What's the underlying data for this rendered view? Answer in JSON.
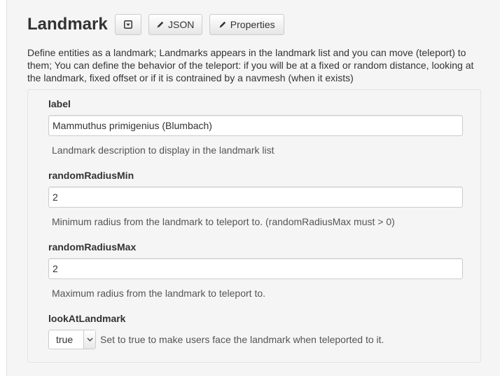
{
  "header": {
    "title": "Landmark",
    "json_button_label": "JSON",
    "properties_button_label": "Properties"
  },
  "description": "Define entities as a landmark; Landmarks appears in the landmark list and you can move (teleport) to them; You can define the behavior of the teleport: if you will be at a fixed or random distance, looking at the landmark, fixed offset or if it is contrained by a navmesh (when it exists)",
  "fields": {
    "label": {
      "name": "label",
      "value": "Mammuthus primigenius (Blumbach)",
      "help": "Landmark description to display in the landmark list"
    },
    "randomRadiusMin": {
      "name": "randomRadiusMin",
      "value": "2",
      "help": "Minimum radius from the landmark to teleport to. (randomRadiusMax must > 0)"
    },
    "randomRadiusMax": {
      "name": "randomRadiusMax",
      "value": "2",
      "help": "Maximum radius from the landmark to teleport to."
    },
    "lookAtLandmark": {
      "name": "lookAtLandmark",
      "value": "true",
      "help": "Set to true to make users face the landmark when teleported to it."
    }
  },
  "icons": {
    "collapse": "caret-square-down-icon",
    "json": "pencil-icon",
    "properties": "pencil-icon"
  },
  "colors": {
    "panel_bg": "#f5f5f5",
    "text": "#333333",
    "help_text": "#555555",
    "border": "#cccccc"
  }
}
